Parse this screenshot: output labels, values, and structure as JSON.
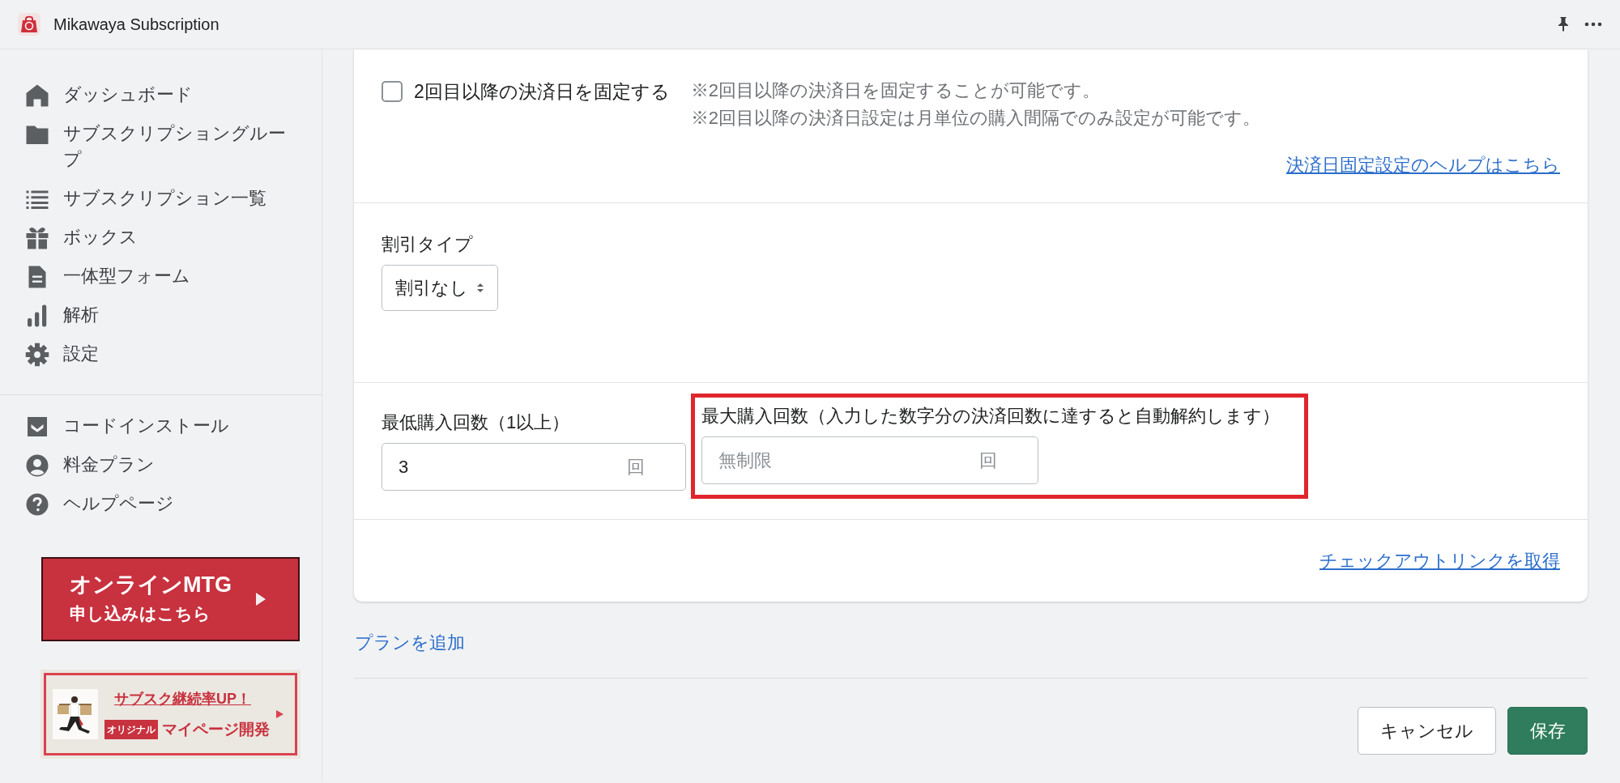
{
  "app_bar": {
    "title": "Mikawaya Subscription"
  },
  "sidebar": {
    "items": [
      {
        "kind": "home",
        "label": "ダッシュボード"
      },
      {
        "kind": "folder",
        "label": "サブスクリプショングループ"
      },
      {
        "kind": "list",
        "label": "サブスクリプション一覧"
      },
      {
        "kind": "gift",
        "label": "ボックス"
      },
      {
        "kind": "document",
        "label": "一体型フォーム"
      },
      {
        "kind": "chart",
        "label": "解析"
      },
      {
        "kind": "gear",
        "label": "設定"
      }
    ],
    "secondary_items": [
      {
        "kind": "inbox",
        "label": "コードインストール"
      },
      {
        "kind": "person",
        "label": "料金プラン"
      },
      {
        "kind": "help",
        "label": "ヘルプページ"
      }
    ],
    "banners": [
      {
        "kind": "meeting",
        "title": "オンラインMTG",
        "subtitle": "申し込みはこちら"
      },
      {
        "kind": "promo",
        "title": "サブスク継続率UP！",
        "tag": "オリジナル",
        "subtitle": "マイページ開発"
      }
    ]
  },
  "plan_card": {
    "fixed_billing": {
      "label": "2回目以降の決済日を固定する",
      "checked": false,
      "notes": [
        "※2回目以降の決済日を固定することが可能です。",
        "※2回目以降の決済日設定は月単位の購入間隔でのみ設定が可能です。"
      ],
      "help_link": "決済日固定設定のヘルプはこちら"
    },
    "discount": {
      "label": "割引タイプ",
      "value": "割引なし"
    },
    "min_purchases": {
      "label": "最低購入回数（1以上）",
      "value": "3",
      "suffix": "回"
    },
    "max_purchases": {
      "label": "最大購入回数（入力した数字分の決済回数に達すると自動解約します）",
      "placeholder": "無制限",
      "suffix": "回",
      "highlighted": true
    },
    "checkout_link": "チェックアウトリンクを取得"
  },
  "add_plan_link": "プランを追加",
  "buttons": [
    {
      "kind": "secondary",
      "label": "キャンセル"
    },
    {
      "kind": "primary",
      "label": "保存"
    }
  ]
}
